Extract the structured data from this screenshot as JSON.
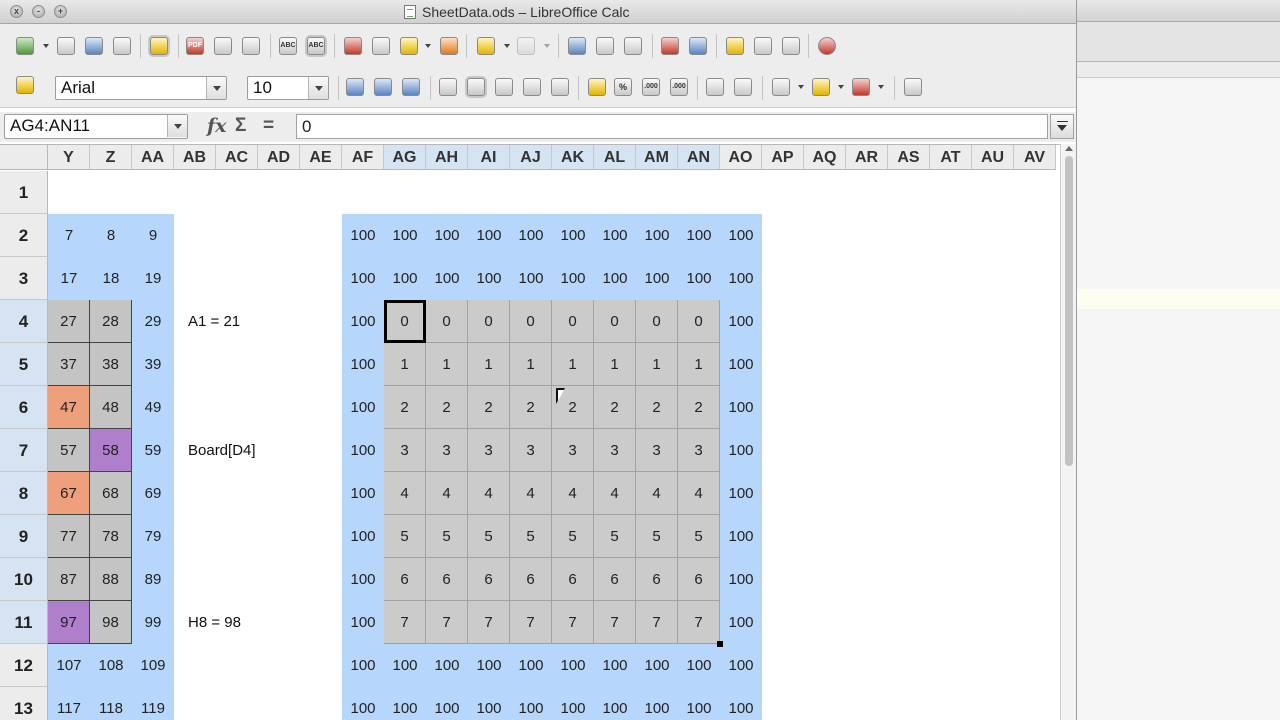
{
  "window": {
    "title": "SheetData.ods – LibreOffice Calc",
    "close_glyph": "x",
    "minimize_glyph": "-",
    "zoom_glyph": "+"
  },
  "toolbar": {
    "standard_icons": [
      "new-icon",
      "open-icon",
      "save-icon",
      "email-icon",
      "edit-file-icon",
      "export-pdf-icon",
      "print-icon",
      "print-preview-icon",
      "spellcheck-icon",
      "autospellcheck-icon",
      "cut-icon",
      "copy-icon",
      "paste-icon",
      "clone-formatting-icon",
      "undo-icon",
      "redo-icon",
      "navigator-icon",
      "sort-ascending-icon",
      "sort-descending-icon",
      "chart-icon",
      "draw-functions-icon",
      "gallery-icon",
      "datasources-icon",
      "zoom-icon",
      "help-icon"
    ],
    "spell_label": "ABC",
    "pdf_label": "PDF",
    "percent_label": "%",
    "decimal_label": ".000"
  },
  "formatting": {
    "font_name": "Arial",
    "font_size": "10"
  },
  "formula_bar": {
    "name_box": "AG4:AN11",
    "fx_symbol": "fx",
    "sum_symbol": "Σ",
    "equals_symbol": "=",
    "content": "0"
  },
  "sheet": {
    "columns": [
      "Y",
      "Z",
      "AA",
      "AB",
      "AC",
      "AD",
      "AE",
      "AF",
      "AG",
      "AH",
      "AI",
      "AJ",
      "AK",
      "AL",
      "AM",
      "AN",
      "AO",
      "AP",
      "AQ",
      "AR",
      "AS",
      "AT",
      "AU",
      "AV"
    ],
    "selected_columns": [
      "AG",
      "AH",
      "AI",
      "AJ",
      "AK",
      "AL",
      "AM",
      "AN"
    ],
    "rows": [
      "1",
      "2",
      "3",
      "4",
      "5",
      "6",
      "7",
      "8",
      "9",
      "10",
      "11",
      "12",
      "13"
    ],
    "selected_rows": [
      "4",
      "5",
      "6",
      "7",
      "8",
      "9",
      "10",
      "11"
    ],
    "left_block": [
      [
        "7",
        "8",
        "9"
      ],
      [
        "17",
        "18",
        "19"
      ],
      [
        "27",
        "28",
        "29"
      ],
      [
        "37",
        "38",
        "39"
      ],
      [
        "47",
        "48",
        "49"
      ],
      [
        "57",
        "58",
        "59"
      ],
      [
        "67",
        "68",
        "69"
      ],
      [
        "77",
        "78",
        "79"
      ],
      [
        "87",
        "88",
        "89"
      ],
      [
        "97",
        "98",
        "99"
      ],
      [
        "107",
        "108",
        "109"
      ],
      [
        "117",
        "118",
        "119"
      ]
    ],
    "labels": [
      {
        "row": "4",
        "text": "A1 = 21"
      },
      {
        "row": "7",
        "text": "Board[D4]"
      },
      {
        "row": "11",
        "text": "H8 = 98"
      }
    ],
    "right_block": [
      [
        "100",
        "100",
        "100",
        "100",
        "100",
        "100",
        "100",
        "100",
        "100",
        "100"
      ],
      [
        "100",
        "100",
        "100",
        "100",
        "100",
        "100",
        "100",
        "100",
        "100",
        "100"
      ],
      [
        "100",
        "0",
        "0",
        "0",
        "0",
        "0",
        "0",
        "0",
        "0",
        "100"
      ],
      [
        "100",
        "1",
        "1",
        "1",
        "1",
        "1",
        "1",
        "1",
        "1",
        "100"
      ],
      [
        "100",
        "2",
        "2",
        "2",
        "2",
        "2",
        "2",
        "2",
        "2",
        "100"
      ],
      [
        "100",
        "3",
        "3",
        "3",
        "3",
        "3",
        "3",
        "3",
        "3",
        "100"
      ],
      [
        "100",
        "4",
        "4",
        "4",
        "4",
        "4",
        "4",
        "4",
        "4",
        "100"
      ],
      [
        "100",
        "5",
        "5",
        "5",
        "5",
        "5",
        "5",
        "5",
        "5",
        "100"
      ],
      [
        "100",
        "6",
        "6",
        "6",
        "6",
        "6",
        "6",
        "6",
        "6",
        "100"
      ],
      [
        "100",
        "7",
        "7",
        "7",
        "7",
        "7",
        "7",
        "7",
        "7",
        "100"
      ],
      [
        "100",
        "100",
        "100",
        "100",
        "100",
        "100",
        "100",
        "100",
        "100",
        "100"
      ],
      [
        "100",
        "100",
        "100",
        "100",
        "100",
        "100",
        "100",
        "100",
        "100",
        "100"
      ]
    ],
    "colors": {
      "blue": "#b6d7fb",
      "gray": "#c4c4c4",
      "orange": "#ee9f7c",
      "purple": "#b07fcc",
      "selection_header": "#d5e3f3"
    }
  }
}
